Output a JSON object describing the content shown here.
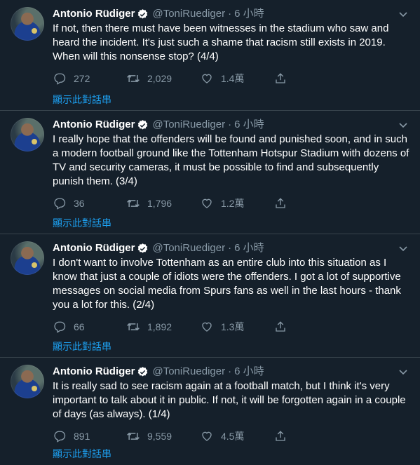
{
  "colors": {
    "background": "#15202b",
    "divider": "#38444d",
    "secondary_text": "#8899a6",
    "link": "#1da1f2",
    "verified_badge": "#ffffff"
  },
  "icons": {
    "reply": "speech-bubble-icon",
    "retweet": "retweet-arrows-icon",
    "like": "heart-icon",
    "share": "share-upload-icon",
    "caret": "chevron-down-icon",
    "verified": "verified-badge-icon"
  },
  "tweets": [
    {
      "name": "Antonio Rüdiger",
      "handle": "@ToniRuediger",
      "dot": "·",
      "time": "6 小時",
      "text": "If not, then there must have been witnesses in the stadium who saw and heard the incident. It's just such a shame that racism still exists in 2019. When will this nonsense stop? (4/4)",
      "replies": "272",
      "retweets": "2,029",
      "likes": "1.4萬",
      "thread_link": "顯示此對話串"
    },
    {
      "name": "Antonio Rüdiger",
      "handle": "@ToniRuediger",
      "dot": "·",
      "time": "6 小時",
      "text": "I really hope that the offenders will be found and punished soon, and in such a modern football ground like the Tottenham Hotspur Stadium with dozens of TV and security cameras, it must be possible to find and subsequently punish them. (3/4)",
      "replies": "36",
      "retweets": "1,796",
      "likes": "1.2萬",
      "thread_link": "顯示此對話串"
    },
    {
      "name": "Antonio Rüdiger",
      "handle": "@ToniRuediger",
      "dot": "·",
      "time": "6 小時",
      "text": "I don't want to involve Tottenham as an entire club into this situation as I know that just a couple of idiots were the offenders. I got a lot of supportive messages on social media from Spurs fans as well in the last hours - thank you a lot for this. (2/4)",
      "replies": "66",
      "retweets": "1,892",
      "likes": "1.3萬",
      "thread_link": "顯示此對話串"
    },
    {
      "name": "Antonio Rüdiger",
      "handle": "@ToniRuediger",
      "dot": "·",
      "time": "6 小時",
      "text": "It is really sad to see racism again at a football match, but I think it's very important to talk about it in public. If not, it will be forgotten again in a couple of days (as always). (1/4)",
      "replies": "891",
      "retweets": "9,559",
      "likes": "4.5萬",
      "thread_link": "顯示此對話串"
    }
  ]
}
